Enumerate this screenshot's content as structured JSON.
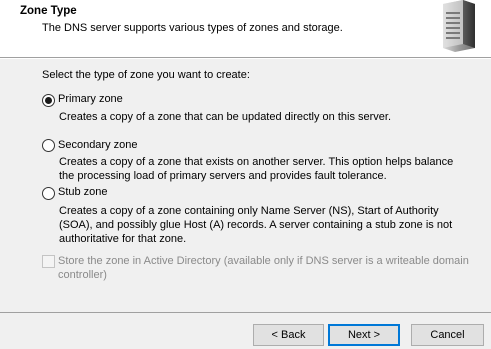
{
  "header": {
    "title": "Zone Type",
    "subtitle": "The DNS server supports various types of zones and storage.",
    "icon": "server-icon"
  },
  "prompt": "Select the type of zone you want to create:",
  "options": [
    {
      "label": "Primary zone",
      "selected": true,
      "description": "Creates a copy of a zone that can be updated directly on this server."
    },
    {
      "label": "Secondary zone",
      "selected": false,
      "description_lines": [
        "Creates a copy of a zone that exists on another server. This option helps balance",
        "the processing load of primary servers and provides fault tolerance."
      ]
    },
    {
      "label": "Stub zone",
      "selected": false,
      "description_lines": [
        "Creates a copy of a zone containing only Name Server (NS), Start of Authority",
        "(SOA), and possibly glue Host (A) records. A server containing a stub zone is not",
        "authoritative for that zone."
      ]
    }
  ],
  "ad_checkbox": {
    "checked": false,
    "enabled": false,
    "label_lines": [
      "Store the zone in Active Directory (available only if DNS server is a writeable domain",
      "controller)"
    ]
  },
  "buttons": {
    "back": "< Back",
    "next": "Next >",
    "cancel": "Cancel"
  },
  "colors": {
    "panel_bg": "#f0f0f0",
    "header_bg": "#ffffff",
    "default_button_border": "#0078d7",
    "disabled_text": "#8a8a8a"
  }
}
